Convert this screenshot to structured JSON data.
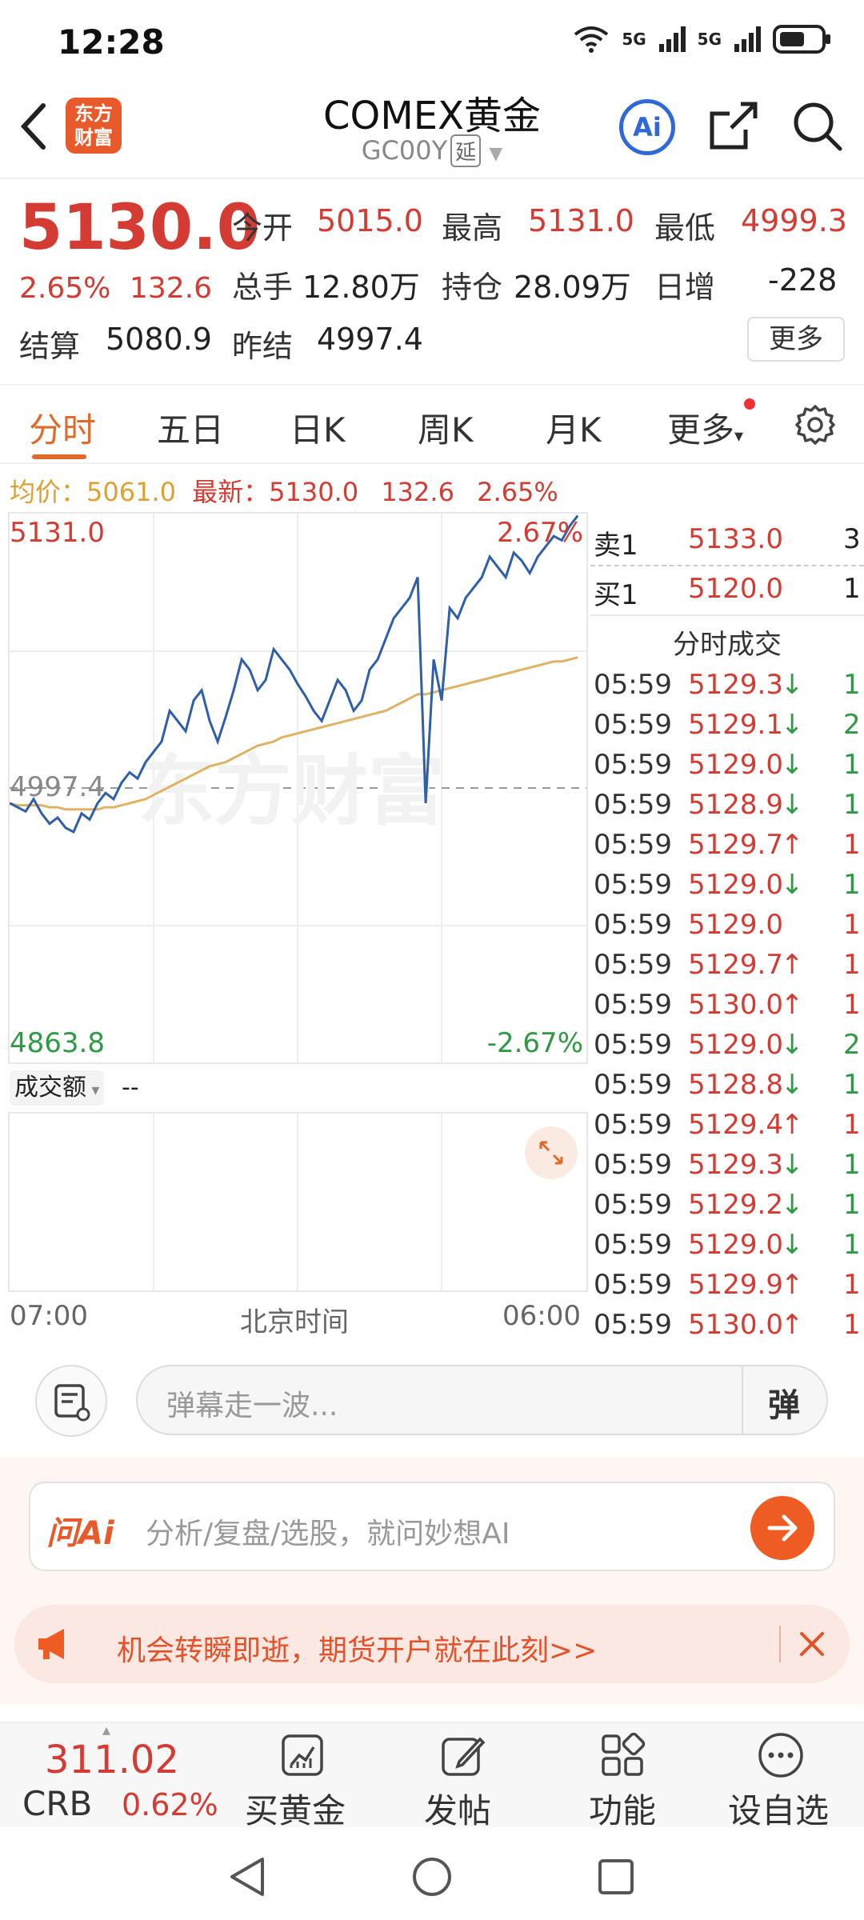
{
  "status": {
    "time": "12:28",
    "net1": "5G",
    "net2": "5G"
  },
  "header": {
    "logo_line1": "东方",
    "logo_line2": "财富",
    "title": "COMEX黄金",
    "code": "GC00Y",
    "delay_tag": "延",
    "ai_label": "Ai"
  },
  "quote": {
    "price": "5130.0",
    "change_pct": "2.65%",
    "change": "132.6",
    "open_label": "今开",
    "open": "5015.0",
    "high_label": "最高",
    "high": "5131.0",
    "low_label": "最低",
    "low": "4999.3",
    "volume_label": "总手",
    "volume": "12.80万",
    "oi_label": "持仓",
    "oi": "28.09万",
    "daily_inc_label": "日增",
    "daily_inc": "-228",
    "settle_label": "结算",
    "settle": "5080.9",
    "prev_settle_label": "昨结",
    "prev_settle": "4997.4",
    "more_label": "更多"
  },
  "tabs": [
    "分时",
    "五日",
    "日K",
    "周K",
    "月K",
    "更多"
  ],
  "chart": {
    "avg_label": "均价：",
    "avg": "5061.0",
    "latest_label": "最新：",
    "latest": "5130.0",
    "latest_change": "132.6",
    "latest_pct": "2.65%",
    "top_price": "5131.0",
    "top_pct": "2.67%",
    "ref_price": "4997.4",
    "bottom_price": "4863.8",
    "bottom_pct": "-2.67%",
    "watermark": "东方财富",
    "volume_label": "成交额",
    "volume_value": "--",
    "x_start": "07:00",
    "x_mid": "北京时间",
    "x_end": "06:00"
  },
  "chart_data": {
    "type": "line",
    "ylim": [
      4863.8,
      5131.0
    ],
    "reference": 4997.4,
    "series_price": [
      4990,
      4988,
      4986,
      4992,
      4985,
      4980,
      4983,
      4978,
      4976,
      4985,
      4982,
      4990,
      4995,
      4992,
      5000,
      5005,
      5002,
      5010,
      5015,
      5020,
      5035,
      5030,
      5025,
      5040,
      5045,
      5030,
      5020,
      5032,
      5045,
      5060,
      5055,
      5045,
      5050,
      5065,
      5060,
      5055,
      5048,
      5042,
      5035,
      5030,
      5040,
      5050,
      5045,
      5035,
      5040,
      5055,
      5060,
      5070,
      5080,
      5085,
      5090,
      5100,
      4990,
      5060,
      5040,
      5085,
      5080,
      5090,
      5095,
      5100,
      5110,
      5105,
      5100,
      5112,
      5108,
      5102,
      5110,
      5115,
      5120,
      5118,
      5125,
      5130
    ],
    "series_avg": [
      4990,
      4989,
      4989,
      4989,
      4989,
      4988,
      4988,
      4987,
      4987,
      4987,
      4987,
      4987,
      4988,
      4988,
      4989,
      4990,
      4991,
      4992,
      4994,
      4996,
      4998,
      5000,
      5002,
      5004,
      5006,
      5008,
      5009,
      5010,
      5012,
      5014,
      5016,
      5018,
      5019,
      5020,
      5022,
      5023,
      5024,
      5025,
      5026,
      5027,
      5028,
      5029,
      5030,
      5031,
      5032,
      5033,
      5034,
      5035,
      5037,
      5039,
      5041,
      5043,
      5043,
      5044,
      5045,
      5046,
      5047,
      5048,
      5049,
      5050,
      5051,
      5052,
      5053,
      5054,
      5055,
      5056,
      5057,
      5058,
      5059,
      5059,
      5060,
      5061
    ]
  },
  "orderbook": {
    "ask_label": "卖1",
    "ask_price": "5133.0",
    "ask_qty": "3",
    "bid_label": "买1",
    "bid_price": "5120.0",
    "bid_qty": "1",
    "trades_title": "分时成交"
  },
  "trades": [
    {
      "time": "05:59",
      "price": "5129.3",
      "dir": "down",
      "qty": "1"
    },
    {
      "time": "05:59",
      "price": "5129.1",
      "dir": "down",
      "qty": "2"
    },
    {
      "time": "05:59",
      "price": "5129.0",
      "dir": "down",
      "qty": "1"
    },
    {
      "time": "05:59",
      "price": "5128.9",
      "dir": "down",
      "qty": "1"
    },
    {
      "time": "05:59",
      "price": "5129.7",
      "dir": "up",
      "qty": "1"
    },
    {
      "time": "05:59",
      "price": "5129.0",
      "dir": "down",
      "qty": "1"
    },
    {
      "time": "05:59",
      "price": "5129.0",
      "dir": "none",
      "qty": "1"
    },
    {
      "time": "05:59",
      "price": "5129.7",
      "dir": "up",
      "qty": "1"
    },
    {
      "time": "05:59",
      "price": "5130.0",
      "dir": "up",
      "qty": "1"
    },
    {
      "time": "05:59",
      "price": "5129.0",
      "dir": "down",
      "qty": "2"
    },
    {
      "time": "05:59",
      "price": "5128.8",
      "dir": "down",
      "qty": "1"
    },
    {
      "time": "05:59",
      "price": "5129.4",
      "dir": "up",
      "qty": "1"
    },
    {
      "time": "05:59",
      "price": "5129.3",
      "dir": "down",
      "qty": "1"
    },
    {
      "time": "05:59",
      "price": "5129.2",
      "dir": "down",
      "qty": "1"
    },
    {
      "time": "05:59",
      "price": "5129.0",
      "dir": "down",
      "qty": "1"
    },
    {
      "time": "05:59",
      "price": "5129.9",
      "dir": "up",
      "qty": "1"
    },
    {
      "time": "05:59",
      "price": "5130.0",
      "dir": "up",
      "qty": "1"
    }
  ],
  "danmu": {
    "placeholder": "弹幕走一波...",
    "send_label": "弹"
  },
  "ai": {
    "label": "问Ai",
    "placeholder": "分析/复盘/选股，就问妙想AI"
  },
  "promo": {
    "text": "机会转瞬即逝，期货开户就在此刻>>"
  },
  "bottom": {
    "index_value": "311.02",
    "index_name": "CRB",
    "index_pct": "0.62%",
    "buy_gold": "买黄金",
    "post": "发帖",
    "functions": "功能",
    "set_watch": "设自选"
  },
  "colors": {
    "up": "#d43b32",
    "down": "#2f9a45",
    "accent": "#e06a2a",
    "line": "#2f5fa8",
    "avg": "#e0b264"
  }
}
